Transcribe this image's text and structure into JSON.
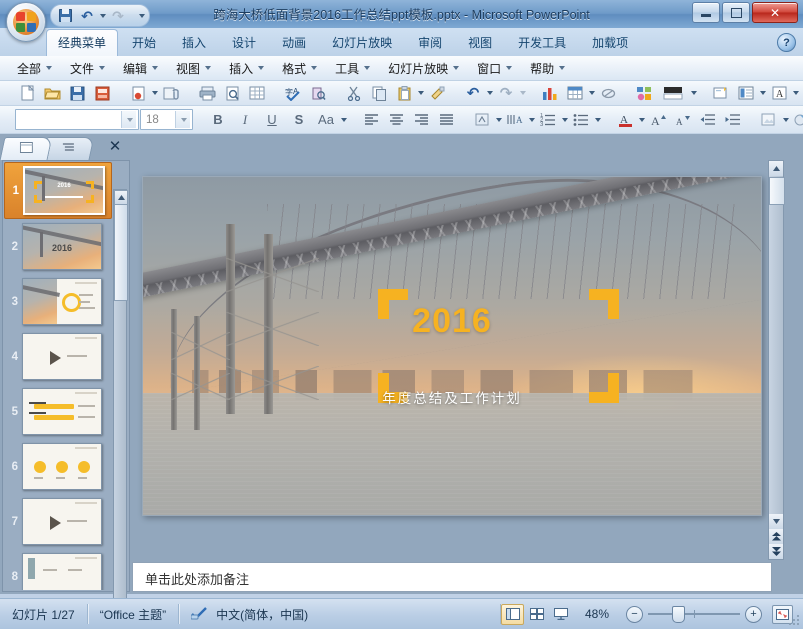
{
  "window": {
    "title": "跨海大桥低面背景2016工作总结ppt模板.pptx  -  Microsoft PowerPoint",
    "minimize_label": "最小化",
    "maximize_label": "最大化",
    "close_label": "✕"
  },
  "quick_access": {
    "items": [
      {
        "name": "office-orb",
        "label": "Office"
      },
      {
        "name": "save-button",
        "label": "保存"
      },
      {
        "name": "undo-button",
        "label": "撤消"
      },
      {
        "name": "redo-button",
        "label": "恢复"
      },
      {
        "name": "customize-qat-button",
        "label": "自定义快速访问工具栏"
      }
    ]
  },
  "ribbon": {
    "tabs": [
      {
        "label": "经典菜单",
        "active": true
      },
      {
        "label": "开始",
        "active": false
      },
      {
        "label": "插入",
        "active": false
      },
      {
        "label": "设计",
        "active": false
      },
      {
        "label": "动画",
        "active": false
      },
      {
        "label": "幻灯片放映",
        "active": false
      },
      {
        "label": "审阅",
        "active": false
      },
      {
        "label": "视图",
        "active": false
      },
      {
        "label": "开发工具",
        "active": false
      },
      {
        "label": "加载项",
        "active": false
      }
    ],
    "help_label": "?"
  },
  "menubar": {
    "items": [
      {
        "label": "全部"
      },
      {
        "label": "文件"
      },
      {
        "label": "编辑"
      },
      {
        "label": "视图"
      },
      {
        "label": "插入"
      },
      {
        "label": "格式"
      },
      {
        "label": "工具"
      },
      {
        "label": "幻灯片放映"
      },
      {
        "label": "窗口"
      },
      {
        "label": "帮助"
      }
    ]
  },
  "toolbar_row1": {
    "icons": [
      "new-document-icon",
      "open-folder-icon",
      "save-icon",
      "save-as-icon",
      "permission-icon",
      "attachment-icon",
      "print-icon",
      "print-preview-icon",
      "table-grid-icon",
      "spelling-check-icon",
      "research-icon",
      "cut-scissors-icon",
      "copy-icon",
      "paste-icon",
      "format-painter-icon",
      "undo-icon",
      "redo-icon",
      "insert-chart-icon",
      "insert-table-icon",
      "hyperlink-icon",
      "smartart-icon",
      "shape-fill-icon",
      "new-slide-icon",
      "slide-layout-icon",
      "text-style-icon",
      "picture-icon",
      "zoom-icon"
    ]
  },
  "toolbar_row2": {
    "font_name": "",
    "font_name_placeholder": "",
    "font_size": "18",
    "buttons": [
      {
        "name": "bold-button",
        "label": "B"
      },
      {
        "name": "italic-button",
        "label": "I"
      },
      {
        "name": "underline-button",
        "label": "U"
      },
      {
        "name": "shadow-button",
        "label": "S"
      },
      {
        "name": "change-case-button",
        "label": "Aa"
      }
    ],
    "align_icons": [
      "align-left-icon",
      "align-center-icon",
      "align-right-icon",
      "align-justify-icon"
    ],
    "extra_icons": [
      "text-direction-icon",
      "line-spacing-icon",
      "numbered-list-icon",
      "bulleted-list-icon",
      "font-color-icon",
      "grow-font-icon",
      "shrink-font-icon",
      "decrease-indent-icon",
      "increase-indent-icon",
      "slide-design-icon",
      "color-scheme-icon",
      "animation-icon",
      "transition-icon"
    ]
  },
  "slides_panel": {
    "tabs": [
      {
        "name": "slides-tab",
        "label": "幻灯片",
        "active": true
      },
      {
        "name": "outline-tab",
        "label": "大纲",
        "active": false
      }
    ],
    "close_label": "✕",
    "thumbnails": [
      {
        "number": "1",
        "kind": "title-bridge",
        "selected": true
      },
      {
        "number": "2",
        "kind": "bridge-2016",
        "selected": false
      },
      {
        "number": "3",
        "kind": "split-donut",
        "selected": false
      },
      {
        "number": "4",
        "kind": "section-play",
        "selected": false
      },
      {
        "number": "5",
        "kind": "bars",
        "selected": false
      },
      {
        "number": "6",
        "kind": "pies",
        "selected": false
      },
      {
        "number": "7",
        "kind": "section-play",
        "selected": false
      },
      {
        "number": "8",
        "kind": "chart-partial",
        "selected": false
      }
    ]
  },
  "slide": {
    "year": "2016",
    "subtitle": "年度总结及工作计划"
  },
  "notes": {
    "placeholder": "单击此处添加备注"
  },
  "statusbar": {
    "slide_counter": "幻灯片 1/27",
    "theme": "“Office 主题”",
    "language": "中文(简体，中国)",
    "spellcheck_icon": "proofing-icon",
    "view_buttons": [
      {
        "name": "normal-view-button",
        "label": "普通视图",
        "active": true
      },
      {
        "name": "slide-sorter-button",
        "label": "幻灯片浏览",
        "active": false
      },
      {
        "name": "slideshow-button",
        "label": "幻灯片放映",
        "active": false
      }
    ],
    "zoom_level": "48%",
    "zoom_out_label": "−",
    "zoom_in_label": "+",
    "fit_label": "适应窗口大小"
  },
  "colors": {
    "accent_orange": "#f6b221",
    "selection_orange": "#e0922f",
    "title_blue": "#1c3c5e",
    "close_red": "#c0392b"
  }
}
